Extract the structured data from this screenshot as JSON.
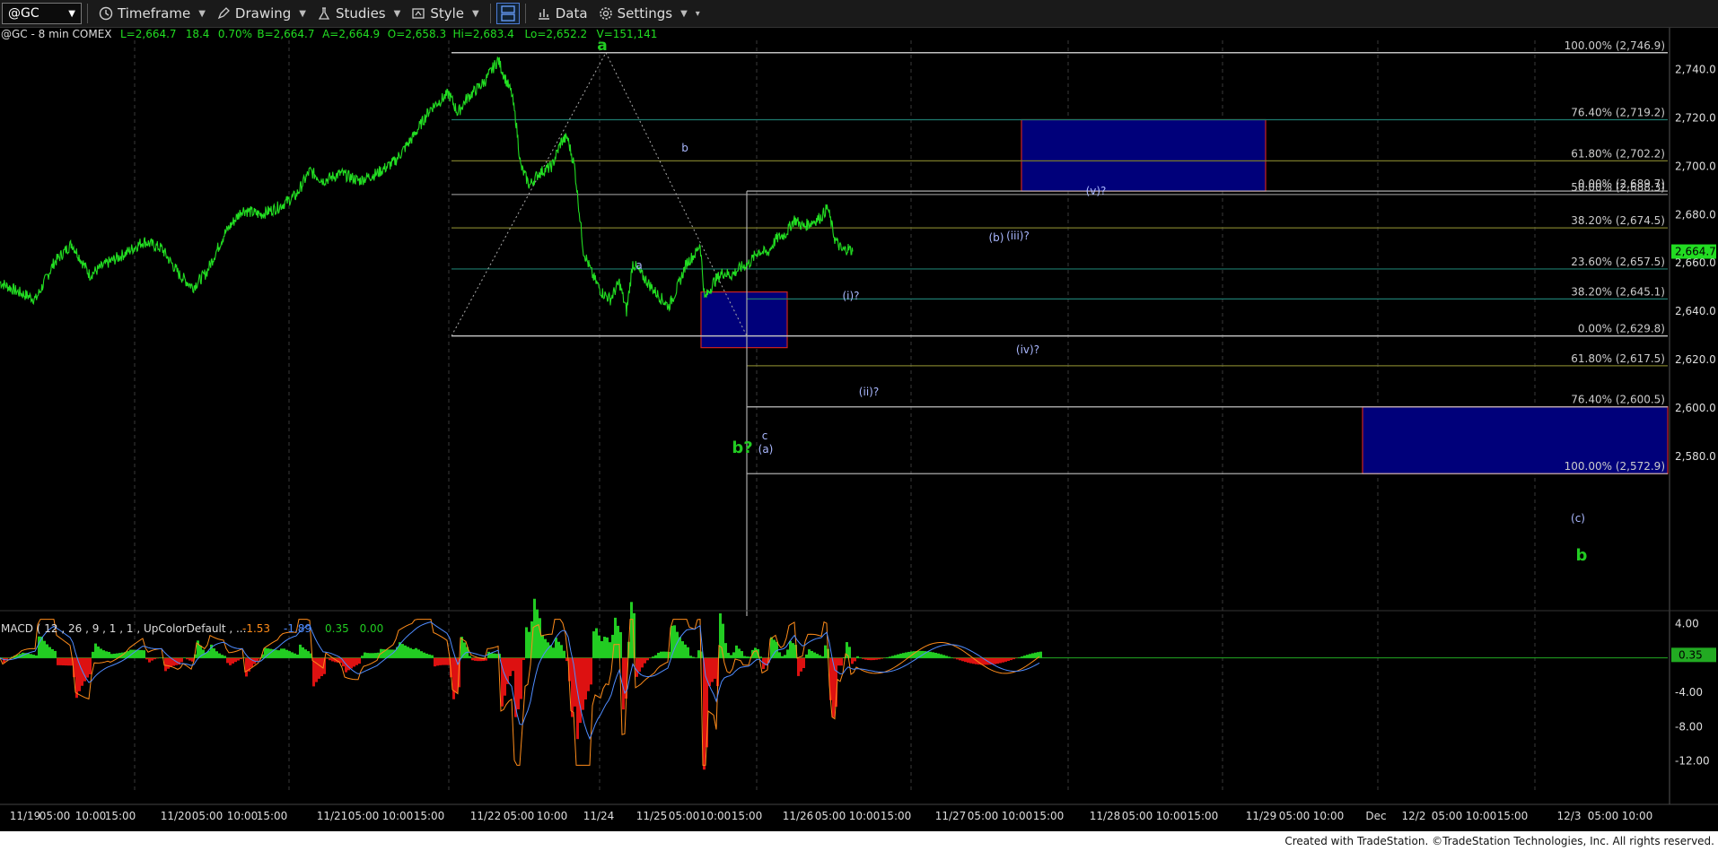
{
  "toolbar": {
    "symbol": "@GC",
    "timeframe_label": "Timeframe",
    "drawing_label": "Drawing",
    "studies_label": "Studies",
    "style_label": "Style",
    "data_label": "Data",
    "settings_label": "Settings"
  },
  "header": {
    "symbol_info": "@GC - 8 min  COMEX",
    "stats": [
      "L=2,664.7",
      "18.4",
      "0.70%",
      "B=2,664.7",
      "A=2,664.9",
      "O=2,658.3",
      "Hi=2,683.4",
      "Lo=2,652.2",
      "V=151,141"
    ]
  },
  "chart_data": {
    "type": "line",
    "title": "@GC - 8 min  COMEX",
    "ylim": [
      2560,
      2752
    ],
    "y_ticks": [
      "2,740.0",
      "2,720.0",
      "2,700.0",
      "2,680.0",
      "2,660.0",
      "2,640.0",
      "2,620.0",
      "2,600.0",
      "2,580.0"
    ],
    "y_tick_values": [
      2740,
      2720,
      2700,
      2680,
      2660,
      2640,
      2620,
      2600,
      2580
    ],
    "last_price_label": "2,664.7",
    "last_price": 2664.7,
    "x_labels": [
      "11/19",
      "05:00",
      "10:00",
      "15:00",
      "11/20",
      "05:00",
      "10:00",
      "15:00",
      "11/21",
      "05:00",
      "10:00",
      "15:00",
      "11/22",
      "05:00",
      "10:00",
      "11/24",
      "11/25",
      "05:00",
      "10:00",
      "15:00",
      "11/26",
      "05:00",
      "10:00",
      "15:00",
      "11/27",
      "05:00",
      "10:00",
      "15:00",
      "11/28",
      "05:00",
      "10:00",
      "15:00",
      "11/29",
      "05:00",
      "10:00",
      "Dec",
      "12/2",
      "05:00",
      "10:00",
      "15:00",
      "12/3",
      "05:00",
      "10:00"
    ],
    "price_path": [
      [
        0,
        2652
      ],
      [
        20,
        2648
      ],
      [
        40,
        2645
      ],
      [
        60,
        2660
      ],
      [
        80,
        2668
      ],
      [
        100,
        2655
      ],
      [
        120,
        2660
      ],
      [
        140,
        2664
      ],
      [
        160,
        2669
      ],
      [
        180,
        2666
      ],
      [
        200,
        2655
      ],
      [
        215,
        2650
      ],
      [
        230,
        2656
      ],
      [
        250,
        2672
      ],
      [
        270,
        2682
      ],
      [
        290,
        2680
      ],
      [
        310,
        2683
      ],
      [
        330,
        2688
      ],
      [
        345,
        2698
      ],
      [
        360,
        2694
      ],
      [
        380,
        2697
      ],
      [
        400,
        2694
      ],
      [
        420,
        2697
      ],
      [
        440,
        2702
      ],
      [
        460,
        2712
      ],
      [
        480,
        2724
      ],
      [
        500,
        2730
      ],
      [
        510,
        2722
      ],
      [
        520,
        2728
      ],
      [
        540,
        2735
      ],
      [
        555,
        2744
      ],
      [
        562,
        2737
      ],
      [
        570,
        2730
      ],
      [
        575,
        2718
      ],
      [
        580,
        2700
      ],
      [
        590,
        2692
      ],
      [
        600,
        2697
      ],
      [
        615,
        2700
      ],
      [
        625,
        2710
      ],
      [
        632,
        2712
      ],
      [
        640,
        2700
      ],
      [
        650,
        2665
      ],
      [
        660,
        2655
      ],
      [
        670,
        2648
      ],
      [
        680,
        2645
      ],
      [
        690,
        2652
      ],
      [
        698,
        2640
      ],
      [
        705,
        2660
      ],
      [
        715,
        2655
      ],
      [
        730,
        2648
      ],
      [
        745,
        2642
      ],
      [
        755,
        2650
      ],
      [
        765,
        2660
      ],
      [
        775,
        2664
      ],
      [
        780,
        2668
      ],
      [
        785,
        2645
      ],
      [
        795,
        2652
      ],
      [
        805,
        2656
      ],
      [
        815,
        2655
      ],
      [
        825,
        2658
      ],
      [
        835,
        2660
      ],
      [
        845,
        2665
      ],
      [
        855,
        2664
      ],
      [
        865,
        2670
      ],
      [
        875,
        2672
      ],
      [
        885,
        2678
      ],
      [
        895,
        2675
      ],
      [
        905,
        2677
      ],
      [
        915,
        2679
      ],
      [
        922,
        2683
      ],
      [
        930,
        2670
      ],
      [
        938,
        2665
      ],
      [
        945,
        2666
      ],
      [
        950,
        2664.7
      ]
    ],
    "price_x_max": 1914,
    "fib_levels": [
      {
        "label": "100.00% (2,746.9)",
        "value": 2746.9,
        "color": "#c0c0c0"
      },
      {
        "label": "76.40% (2,719.2)",
        "value": 2719.2,
        "color": "#1e7a6e"
      },
      {
        "label": "61.80% (2,702.2)",
        "value": 2702.2,
        "color": "#7a7a2a"
      },
      {
        "label": "50.00% (2,688.3)",
        "value": 2688.3,
        "color": "#8a8a8a"
      },
      {
        "label": "38.20% (2,674.5)",
        "value": 2674.5,
        "color": "#7a7a2a"
      },
      {
        "label": "23.60% (2,657.5)",
        "value": 2657.5,
        "color": "#1e7a6e"
      },
      {
        "label": "0.00% (2,629.8)",
        "value": 2629.8,
        "color": "#c0c0c0"
      }
    ],
    "fib_levels_2": [
      {
        "label": "0.00% (2,689.7)",
        "value": 2689.7,
        "color": "#c0c0c0"
      },
      {
        "label": "38.20% (2,645.1)",
        "value": 2645.1,
        "color": "#1e7a6e"
      },
      {
        "label": "61.80% (2,617.5)",
        "value": 2617.5,
        "color": "#7a7a2a"
      },
      {
        "label": "76.40% (2,600.5)",
        "value": 2600.5,
        "color": "#c0c0c0"
      },
      {
        "label": "100.00% (2,572.9)",
        "value": 2572.9,
        "color": "#c0c0c0"
      }
    ],
    "target_boxes": [
      {
        "low": 2689.7,
        "high": 2719.2
      },
      {
        "low": 2625.0,
        "high": 2648.0
      },
      {
        "low": 2572.9,
        "high": 2600.5
      }
    ],
    "wave_labels": [
      {
        "text": "a",
        "color": "#22cc22",
        "bold": true
      },
      {
        "text": "b",
        "color": "#aab8ff",
        "bold": false
      },
      {
        "text": "a",
        "color": "#aab8ff",
        "bold": false
      },
      {
        "text": "b?",
        "color": "#22cc22",
        "bold": true
      },
      {
        "text": "c",
        "color": "#aab8ff",
        "bold": false
      },
      {
        "text": "(a)",
        "color": "#aab8ff",
        "bold": false
      },
      {
        "text": "(i)?",
        "color": "#aab8ff",
        "bold": false
      },
      {
        "text": "(ii)?",
        "color": "#aab8ff",
        "bold": false
      },
      {
        "text": "(b)",
        "color": "#aab8ff",
        "bold": false
      },
      {
        "text": "(iii)?",
        "color": "#aab8ff",
        "bold": false
      },
      {
        "text": "(iv)?",
        "color": "#aab8ff",
        "bold": false
      },
      {
        "text": "(v)?",
        "color": "#aab8ff",
        "bold": false
      },
      {
        "text": "(c)",
        "color": "#aab8ff",
        "bold": false
      },
      {
        "text": "b",
        "color": "#22cc22",
        "bold": true
      }
    ]
  },
  "macd": {
    "header": "MACD ( 12 , 26 , 9 , 1 , 1 , UpColorDefault , ...",
    "values": [
      "-1.53",
      "-1.89",
      "0.35",
      "0.00"
    ],
    "value_colors": [
      "#ff8c1a",
      "#4f8cff",
      "#22cc22",
      "#22cc22"
    ],
    "y_ticks": [
      "4.00",
      "-4.00",
      "-8.00",
      "-12.00"
    ],
    "y_tick_values": [
      4,
      -4,
      -8,
      -12
    ],
    "ylim": [
      -13.5,
      5.5
    ],
    "current_label": "0.35",
    "current_value": 0.35
  },
  "footer": {
    "credit": "Created with TradeStation. ©TradeStation Technologies, Inc. All rights reserved."
  },
  "colors": {
    "background": "#000000",
    "price": "#22dd22",
    "grid": "#3a3a3a",
    "box_fill": "#00007a",
    "box_stroke": "#cc2222"
  }
}
